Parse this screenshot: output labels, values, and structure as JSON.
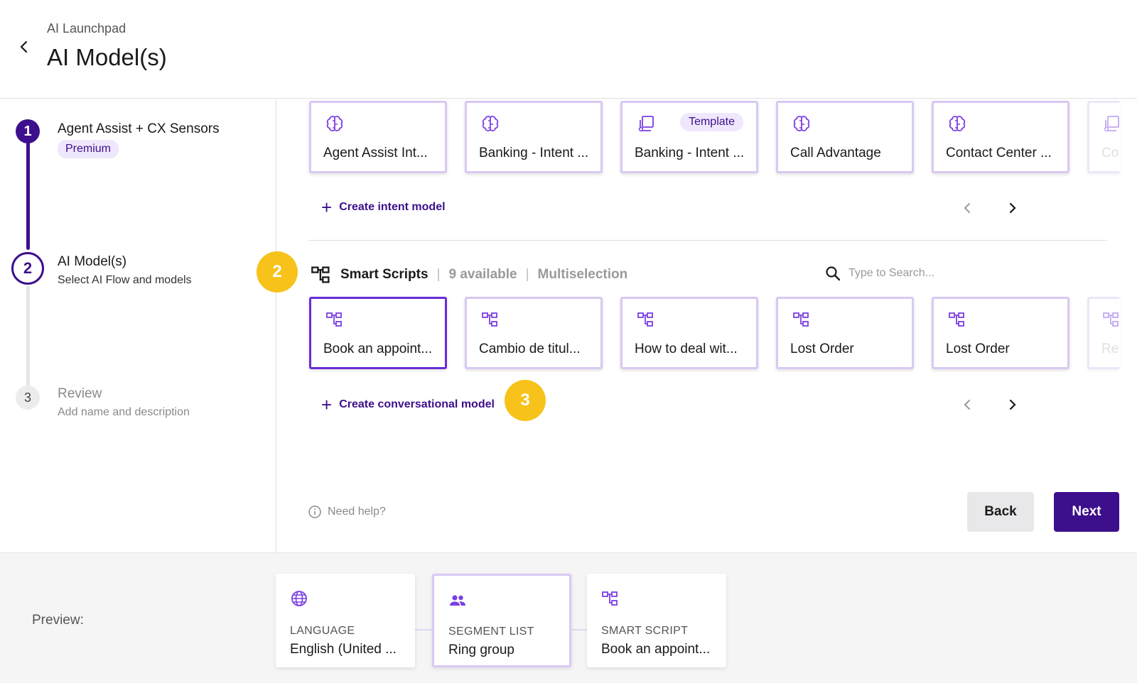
{
  "header": {
    "breadcrumb": "AI Launchpad",
    "title": "AI Model(s)"
  },
  "steps": [
    {
      "number": "1",
      "title": "Agent Assist + CX Sensors",
      "badge": "Premium",
      "state": "done"
    },
    {
      "number": "2",
      "title": "AI Model(s)",
      "subtitle": "Select AI Flow and models",
      "state": "active"
    },
    {
      "number": "3",
      "title": "Review",
      "subtitle": "Add name and description",
      "state": "pending"
    }
  ],
  "intent_models": {
    "cards": [
      {
        "label": "Agent Assist Int...",
        "icon": "brain-icon"
      },
      {
        "label": "Banking - Intent ...",
        "icon": "brain-icon"
      },
      {
        "label": "Banking - Intent ...",
        "icon": "template-icon",
        "tag": "Template"
      },
      {
        "label": "Call Advantage",
        "icon": "brain-icon"
      },
      {
        "label": "Contact Center ...",
        "icon": "brain-icon"
      },
      {
        "label": "Co",
        "icon": "template-icon"
      }
    ],
    "create_label": "Create intent model"
  },
  "smart_scripts": {
    "title": "Smart Scripts",
    "available": "9 available",
    "mode": "Multiselection",
    "search_placeholder": "Type to Search...",
    "cards": [
      {
        "label": "Book an appoint...",
        "icon": "flow-icon",
        "selected": true
      },
      {
        "label": "Cambio de titul...",
        "icon": "flow-icon"
      },
      {
        "label": "How to deal wit...",
        "icon": "flow-icon"
      },
      {
        "label": "Lost Order",
        "icon": "flow-icon"
      },
      {
        "label": "Lost Order",
        "icon": "flow-icon"
      },
      {
        "label": "Re",
        "icon": "flow-icon"
      }
    ],
    "create_label": "Create conversational model"
  },
  "callouts": [
    "2",
    "3"
  ],
  "footer": {
    "help": "Need help?",
    "back": "Back",
    "next": "Next"
  },
  "preview": {
    "label": "Preview:",
    "cards": [
      {
        "caption": "LANGUAGE",
        "value": "English (United ...",
        "icon": "globe-icon"
      },
      {
        "caption": "SEGMENT LIST",
        "value": "Ring group",
        "icon": "people-icon"
      },
      {
        "caption": "SMART SCRIPT",
        "value": "Book an appoint...",
        "icon": "flow-icon"
      }
    ]
  },
  "colors": {
    "primary": "#3d0f8c",
    "accent": "#6a2bd9",
    "card_border": "#d9c8f3",
    "callout": "#f7c21a"
  }
}
